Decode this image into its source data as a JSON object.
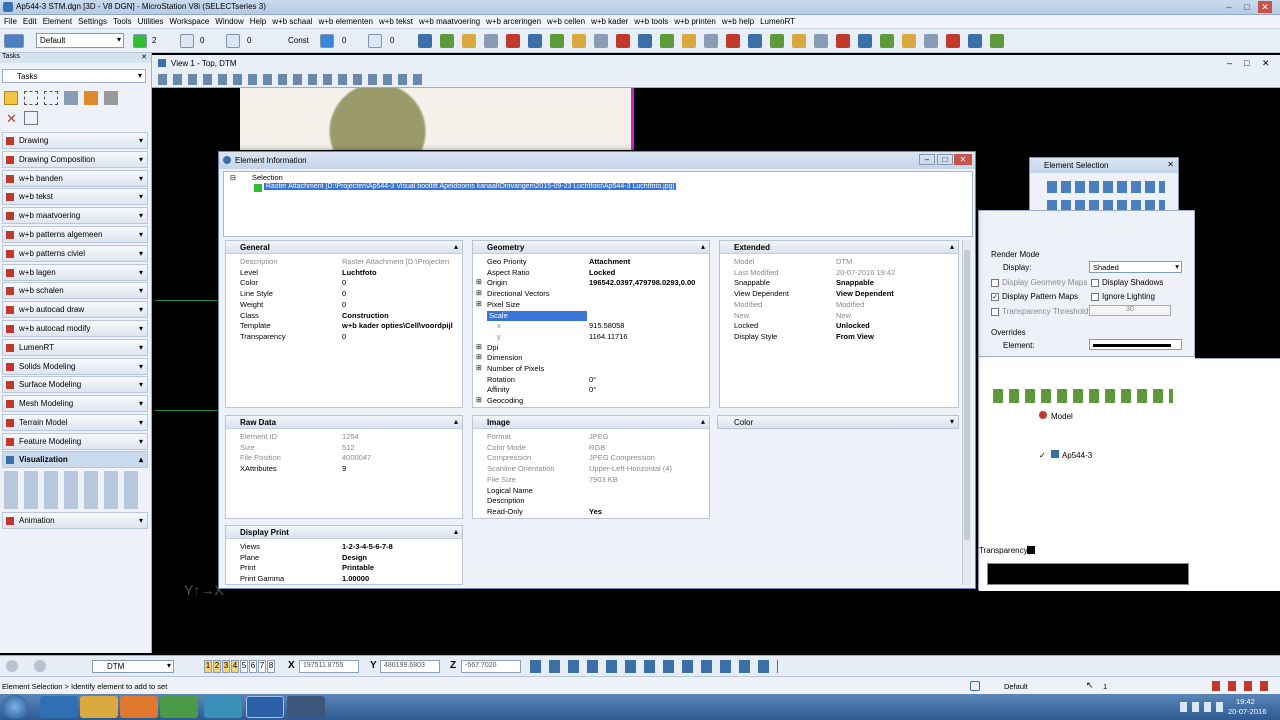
{
  "window": {
    "title": "Ap544-3 STM.dgn [3D - V8 DGN] - MicroStation V8i (SELECTseries 3)"
  },
  "menu": [
    "File",
    "Edit",
    "Element",
    "Settings",
    "Tools",
    "Utilities",
    "Workspace",
    "Window",
    "Help",
    "w+b schaal",
    "w+b elementen",
    "w+b tekst",
    "w+b maatvoering",
    "w+b arceringen",
    "w+b cellen",
    "w+b kader",
    "w+b tools",
    "w+b printen",
    "w+b help",
    "LumenRT"
  ],
  "toolbar": {
    "level": "Default",
    "color_num": "2",
    "style_num": "0",
    "weight_num": "0",
    "const_label": "Const",
    "num1": "0",
    "num2": "0"
  },
  "tasks": {
    "header": "Tasks",
    "dropdown": "Tasks",
    "items": [
      "Drawing",
      "Drawing Composition",
      "w+b banden",
      "w+b tekst",
      "w+b maatvoering",
      "w+b patterns algemeen",
      "w+b patterns civiel",
      "w+b lagen",
      "w+b schalen",
      "w+b autocad draw",
      "w+b autocad modify",
      "LumenRT",
      "Solids Modeling",
      "Surface Modeling",
      "Mesh Modeling",
      "Terrain Model",
      "Feature Modeling"
    ],
    "visualization": "Visualization",
    "animation": "Animation"
  },
  "view": {
    "title": "View 1 - Top, DTM"
  },
  "element_info": {
    "title": "Element Information",
    "selection_label": "Selection",
    "selected_item": "Raster Attachment [D:\\Projecten\\Ap544-3 Visual bootlift Apeldoorns kanaal\\Ontvangen\\2015-09-23 Luchtfoto\\Ap544-3 Luchtfoto.jpg]",
    "general": {
      "header": "General",
      "rows": [
        {
          "k": "Description",
          "v": "Raster Attachment [D:\\Projecten"
        },
        {
          "k": "Level",
          "v": "Luchtfoto"
        },
        {
          "k": "Color",
          "v": "0"
        },
        {
          "k": "Line Style",
          "v": "0"
        },
        {
          "k": "Weight",
          "v": "0"
        },
        {
          "k": "Class",
          "v": "Construction"
        },
        {
          "k": "Template",
          "v": "w+b kader opties\\Cell\\voordpijl"
        },
        {
          "k": "Transparency",
          "v": "0"
        }
      ]
    },
    "geometry": {
      "header": "Geometry",
      "rows": [
        {
          "k": "Geo Priority",
          "v": "Attachment"
        },
        {
          "k": "Aspect Ratio",
          "v": "Locked"
        },
        {
          "k": "Origin",
          "v": "196542.0397,479798.0293,0.00"
        },
        {
          "k": "Directional Vectors",
          "v": ""
        },
        {
          "k": "Pixel Size",
          "v": ""
        },
        {
          "k": "Scale",
          "v": ""
        },
        {
          "k": "x",
          "v": "915.58058"
        },
        {
          "k": "y",
          "v": "1164.11716"
        },
        {
          "k": "Dpi",
          "v": ""
        },
        {
          "k": "Dimension",
          "v": ""
        },
        {
          "k": "Number of Pixels",
          "v": ""
        },
        {
          "k": "Rotation",
          "v": "0°"
        },
        {
          "k": "Affinity",
          "v": "0°"
        },
        {
          "k": "Geocoding",
          "v": ""
        }
      ]
    },
    "extended": {
      "header": "Extended",
      "rows": [
        {
          "k": "Model",
          "v": "DTM"
        },
        {
          "k": "Last Modified",
          "v": "20-07-2016 19:42"
        },
        {
          "k": "Snappable",
          "v": "Snappable"
        },
        {
          "k": "View Dependent",
          "v": "View Dependent"
        },
        {
          "k": "Modified",
          "v": "Modified"
        },
        {
          "k": "New",
          "v": "New"
        },
        {
          "k": "Locked",
          "v": "Unlocked"
        },
        {
          "k": "Display Style",
          "v": "From View"
        }
      ]
    },
    "raw_data": {
      "header": "Raw Data",
      "rows": [
        {
          "k": "Element ID",
          "v": "1254"
        },
        {
          "k": "Size",
          "v": "512"
        },
        {
          "k": "File Position",
          "v": "4000047"
        },
        {
          "k": "XAttributes",
          "v": "9"
        }
      ]
    },
    "image": {
      "header": "Image",
      "rows": [
        {
          "k": "Format",
          "v": "JPEG"
        },
        {
          "k": "Color Mode",
          "v": "RGB"
        },
        {
          "k": "Compression",
          "v": "JPEG Compression"
        },
        {
          "k": "Scanline Orientation",
          "v": "Upper-Left-Horizontal (4)"
        },
        {
          "k": "File Size",
          "v": "7903 KB"
        },
        {
          "k": "Logical Name",
          "v": ""
        },
        {
          "k": "Description",
          "v": ""
        },
        {
          "k": "Read-Only",
          "v": "Yes"
        }
      ]
    },
    "color": {
      "header": "Color"
    },
    "display_print": {
      "header": "Display Print",
      "rows": [
        {
          "k": "Views",
          "v": "1-2-3-4-5-6-7-8"
        },
        {
          "k": "Plane",
          "v": "Design"
        },
        {
          "k": "Print",
          "v": "Printable"
        },
        {
          "k": "Print Gamma",
          "v": "1.00000"
        }
      ]
    }
  },
  "element_selection": {
    "title": "Element Selection"
  },
  "right_panel": {
    "render_mode": "Render Mode",
    "display_label": "Display:",
    "display_value": "Shaded",
    "display_geometry_maps": "Display Geometry Maps",
    "display_shadows": "Display Shadows",
    "display_pattern_maps": "Display Pattern Maps",
    "ignore_lighting": "Ignore Lighting",
    "transparency_threshold": "Transparency Threshold",
    "threshold_value": "30",
    "overrides": "Overrides",
    "element_label": "Element:",
    "model_col": "Model",
    "model_item": "Ap544-3",
    "transparency_label": "Transparency:"
  },
  "status": {
    "model": "DTM",
    "views": [
      "1",
      "2",
      "3",
      "4",
      "5",
      "6",
      "7",
      "8"
    ],
    "x_label": "X",
    "x_value": "197511.8755",
    "y_label": "Y",
    "y_value": "480199.6803",
    "z_label": "Z",
    "z_value": "-567.7020",
    "prompt": "Element Selection > Identify element to add to set",
    "level": "Default",
    "count": "1"
  },
  "clock": {
    "time": "19:42",
    "date": "20-07-2016"
  }
}
